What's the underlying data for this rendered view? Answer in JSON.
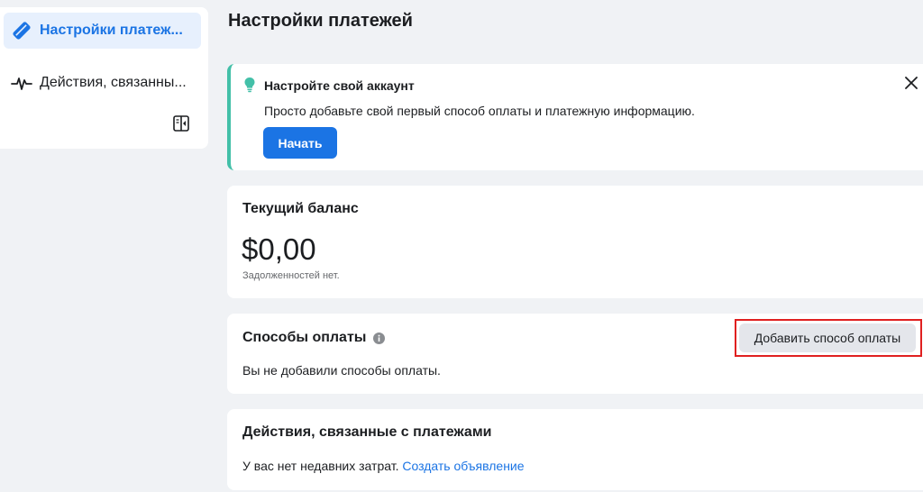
{
  "sidebar": {
    "items": [
      {
        "label": "Настройки платеж...",
        "icon": "card-pen-icon",
        "active": true
      },
      {
        "label": "Действия, связанны...",
        "icon": "activity-pulse-icon",
        "active": false
      }
    ],
    "collapse_icon": "collapse-panel-icon"
  },
  "page": {
    "title": "Настройки платежей"
  },
  "banner": {
    "title": "Настройте свой аккаунт",
    "text": "Просто добавьте свой первый способ оплаты и платежную информацию.",
    "start_label": "Начать",
    "accent_color": "#43c0a8"
  },
  "balance": {
    "title": "Текущий баланс",
    "amount": "$0,00",
    "note": "Задолженностей нет."
  },
  "payment_methods": {
    "title": "Способы оплаты",
    "add_label": "Добавить способ оплаты",
    "empty_text": "Вы не добавили способы оплаты."
  },
  "activity": {
    "title": "Действия, связанные с платежами",
    "text": "У вас нет недавних затрат.",
    "link_label": "Создать объявление"
  },
  "colors": {
    "brand": "#1b74e4",
    "highlight": "#e02020",
    "background": "#f0f2f5"
  }
}
